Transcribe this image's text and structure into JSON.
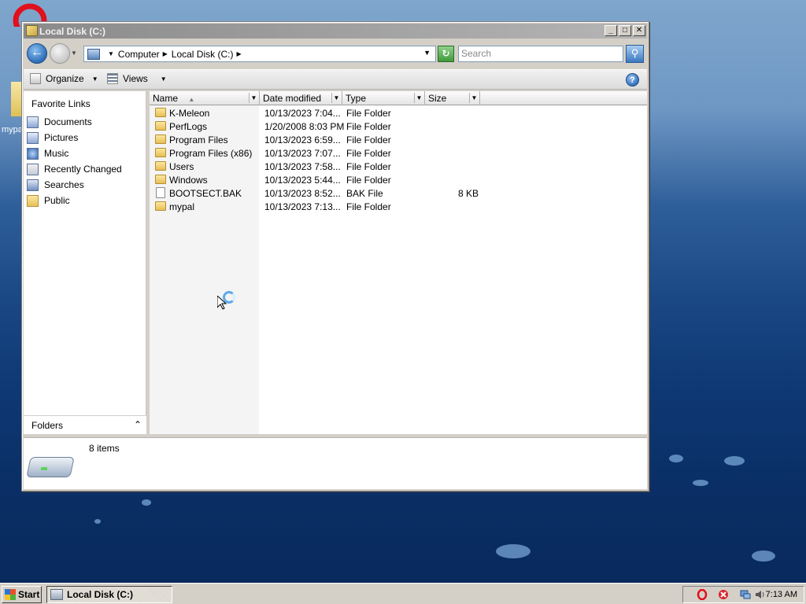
{
  "desktop": {
    "icon_label": "mypa"
  },
  "window": {
    "title": "Local Disk (C:)",
    "minimize": "_",
    "maximize": "□",
    "close": "✕"
  },
  "address": {
    "crumbs": [
      "Computer",
      "Local Disk (C:)"
    ],
    "search_placeholder": "Search"
  },
  "toolbar": {
    "organize_label": "Organize",
    "views_label": "Views",
    "help_label": "?"
  },
  "nav": {
    "heading": "Favorite Links",
    "items": [
      {
        "label": "Documents",
        "icon": "documents-icon"
      },
      {
        "label": "Pictures",
        "icon": "pictures-icon"
      },
      {
        "label": "Music",
        "icon": "music-icon"
      },
      {
        "label": "Recently Changed",
        "icon": "recently-changed-icon"
      },
      {
        "label": "Searches",
        "icon": "searches-icon"
      },
      {
        "label": "Public",
        "icon": "folder-icon"
      }
    ],
    "folders_label": "Folders"
  },
  "filelist": {
    "columns": [
      "Name",
      "Date modified",
      "Type",
      "Size"
    ],
    "rows": [
      {
        "name": "K-Meleon",
        "date": "10/13/2023 7:04...",
        "type": "File Folder",
        "size": "",
        "kind": "folder"
      },
      {
        "name": "PerfLogs",
        "date": "1/20/2008 8:03 PM",
        "type": "File Folder",
        "size": "",
        "kind": "folder"
      },
      {
        "name": "Program Files",
        "date": "10/13/2023 6:59...",
        "type": "File Folder",
        "size": "",
        "kind": "folder"
      },
      {
        "name": "Program Files (x86)",
        "date": "10/13/2023 7:07...",
        "type": "File Folder",
        "size": "",
        "kind": "folder"
      },
      {
        "name": "Users",
        "date": "10/13/2023 7:58...",
        "type": "File Folder",
        "size": "",
        "kind": "folder"
      },
      {
        "name": "Windows",
        "date": "10/13/2023 5:44...",
        "type": "File Folder",
        "size": "",
        "kind": "folder"
      },
      {
        "name": "BOOTSECT.BAK",
        "date": "10/13/2023 8:52...",
        "type": "BAK File",
        "size": "8 KB",
        "kind": "file"
      },
      {
        "name": "mypal",
        "date": "10/13/2023 7:13...",
        "type": "File Folder",
        "size": "",
        "kind": "folder"
      }
    ]
  },
  "details": {
    "count": "8 items"
  },
  "taskbar": {
    "start_label": "Start",
    "task_label": "Local Disk (C:)",
    "clock": "7:13 AM"
  }
}
